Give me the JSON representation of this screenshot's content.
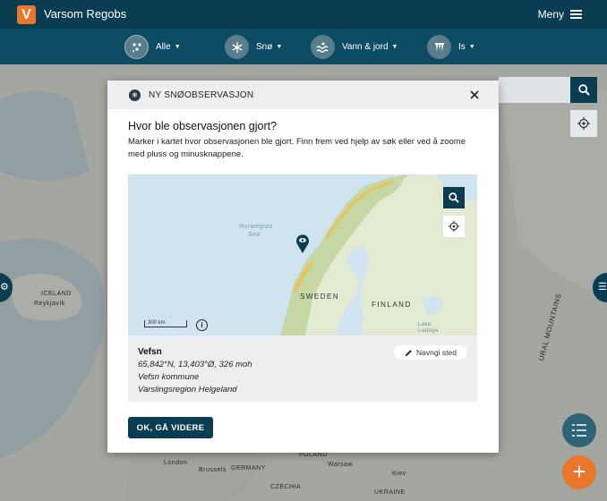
{
  "header": {
    "logo_letter": "V",
    "app_title": "Varsom Regobs",
    "menu_label": "Meny"
  },
  "filters": [
    {
      "label": "Alle",
      "icon": "all-hazards-icon"
    },
    {
      "label": "Snø",
      "icon": "snowflake-icon"
    },
    {
      "label": "Vann & jord",
      "icon": "water-soil-icon"
    },
    {
      "label": "Is",
      "icon": "ice-icon"
    }
  ],
  "background_map": {
    "labels": {
      "iceland": "ICELAND",
      "reykjavik": "Reykjavík",
      "london": "London",
      "brussels": "Brussels",
      "germany": "GERMANY",
      "poland": "POLAND",
      "warsaw": "Warsaw",
      "kiev": "Kiev",
      "czechia": "CZECHIA",
      "ukraine": "UKRAINE",
      "ural": "URAL MOUNTAINS"
    }
  },
  "modal": {
    "title": "NY SNØOBSERVASJON",
    "question": "Hvor ble observasjonen gjort?",
    "instructions": "Marker i kartet hvor observasjonen ble gjort. Finn frem ved hjelp av søk eller ved å zoome med pluss og minusknappene.",
    "map": {
      "labels": {
        "norwegian_sea_1": "Norwegian",
        "norwegian_sea_2": "Sea",
        "sweden": "SWEDEN",
        "finland": "FINLAND",
        "lake_1": "Lake",
        "lake_2": "Ladoga"
      },
      "scale_label": "300 km"
    },
    "place": {
      "name": "Vefsn",
      "coords": "65,842°N, 13,403°Ø, 326 moh",
      "municipality": "Vefsn kommune",
      "region": "Varslingsregion Helgeland",
      "rename_label": "Navngi sted"
    },
    "ok_label": "OK, GÅ VIDERE"
  },
  "colors": {
    "brand_dark": "#0a3c52",
    "accent_orange": "#e8762c",
    "filter_bar": "#0d4a63"
  }
}
